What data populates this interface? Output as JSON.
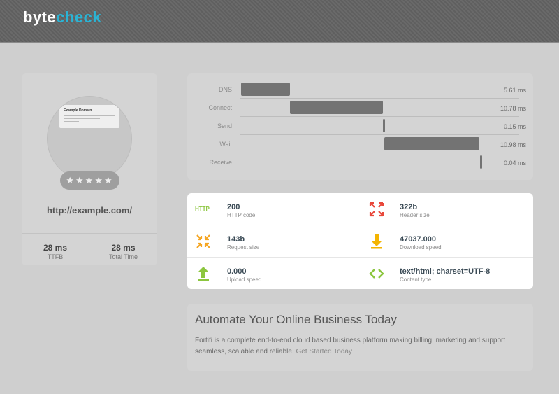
{
  "header": {
    "logo_part1": "byte",
    "logo_part2": "check"
  },
  "site": {
    "thumbnail_title": "Example Domain",
    "rating_stars": "★★★★★",
    "url": "http://example.com/",
    "stats": [
      {
        "value": "28 ms",
        "label": "TTFB"
      },
      {
        "value": "28 ms",
        "label": "Total Time"
      }
    ]
  },
  "timing": [
    {
      "label": "DNS",
      "value": "5.61 ms",
      "start": 0,
      "duration": 5.61
    },
    {
      "label": "Connect",
      "value": "10.78 ms",
      "start": 5.61,
      "duration": 10.78
    },
    {
      "label": "Send",
      "value": "0.15 ms",
      "start": 16.39,
      "duration": 0.15
    },
    {
      "label": "Wait",
      "value": "10.98 ms",
      "start": 16.54,
      "duration": 10.98
    },
    {
      "label": "Receive",
      "value": "0.04 ms",
      "start": 27.52,
      "duration": 0.04
    }
  ],
  "http_info": [
    {
      "icon": "http-text-icon",
      "icon_text": "HTTP",
      "value": "200",
      "label": "HTTP code"
    },
    {
      "icon": "expand-arrows-icon",
      "value": "322b",
      "label": "Header size"
    },
    {
      "icon": "compress-arrows-icon",
      "value": "143b",
      "label": "Request size"
    },
    {
      "icon": "download-arrow-icon",
      "value": "47037.000",
      "label": "Download speed"
    },
    {
      "icon": "upload-arrow-icon",
      "value": "0.000",
      "label": "Upload speed"
    },
    {
      "icon": "code-brackets-icon",
      "value": "text/html; charset=UTF-8",
      "label": "Content type"
    }
  ],
  "promo": {
    "title": "Automate Your Online Business Today",
    "text": "Fortifi is a complete end-to-end cloud based business platform making billing, marketing and support seamless, scalable and reliable.",
    "link": "Get Started Today"
  },
  "colors": {
    "accent": "#2bb3d4",
    "green": "#8cc63f",
    "red": "#e8473a",
    "orange": "#f5a623",
    "yellow": "#f4b400"
  }
}
